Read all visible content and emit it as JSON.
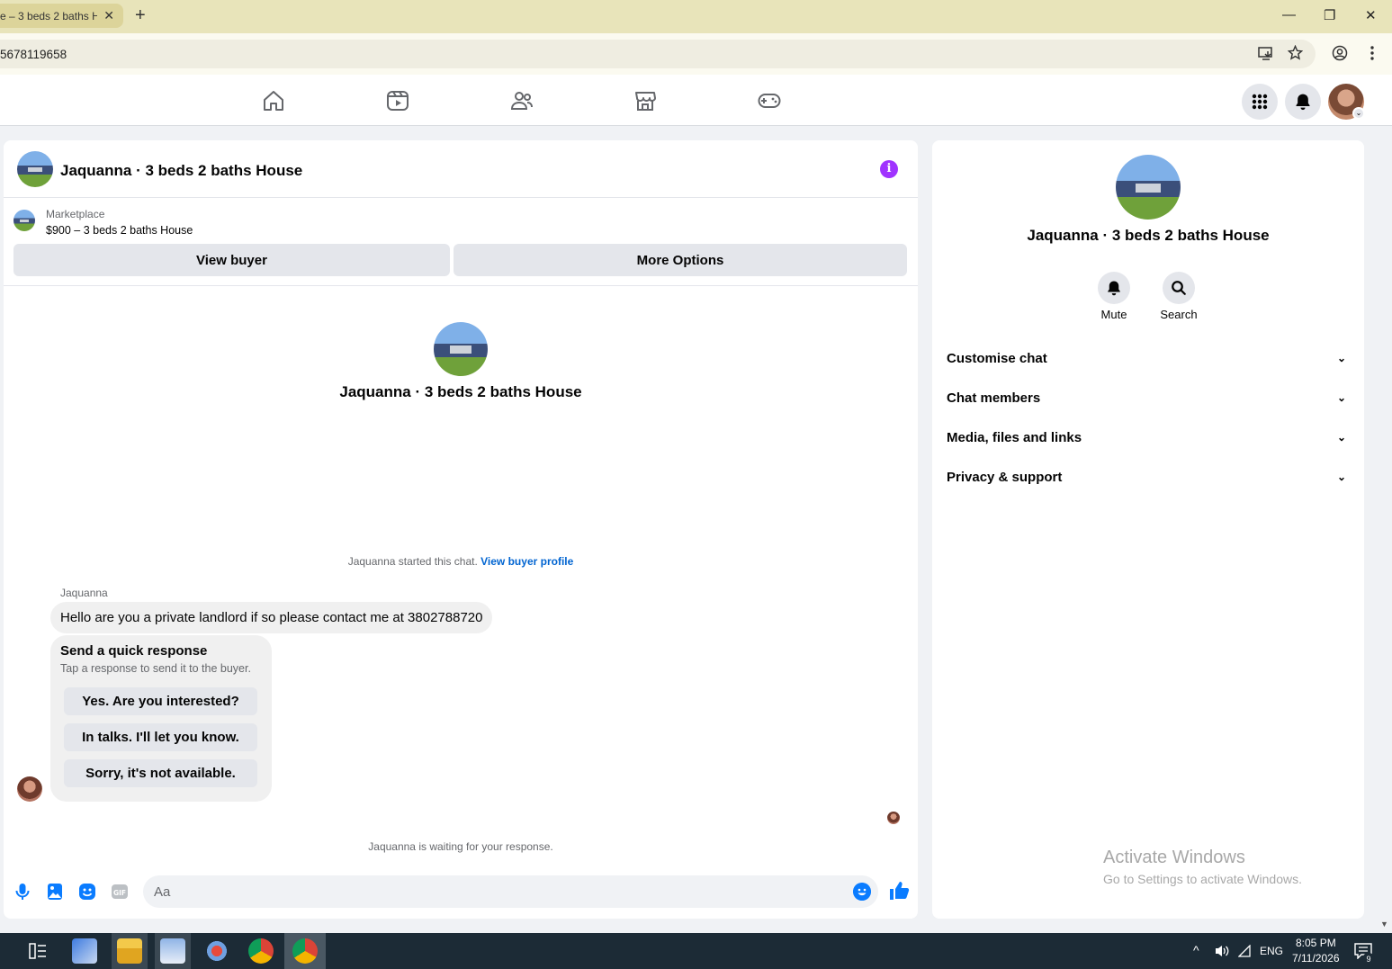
{
  "browser": {
    "tab_title": "e – 3 beds 2 baths H",
    "tab_close": "✕",
    "new_tab": "+",
    "url": "5678119658",
    "window_controls": {
      "minimize": "—",
      "restore": "❐",
      "close": "✕"
    }
  },
  "fb_nav": {
    "icons": [
      "home-icon",
      "video-icon",
      "friends-icon",
      "marketplace-icon",
      "gaming-icon"
    ]
  },
  "chat": {
    "title": "Jaquanna · 3 beds 2 baths House",
    "marketplace_label": "Marketplace",
    "listing_price": "$900 – 3 beds 2 baths House",
    "view_buyer_button": "View buyer",
    "more_options_button": "More Options",
    "center_name": "Jaquanna · 3 beds 2 baths House",
    "started_text": "Jaquanna started this chat.",
    "view_buyer_profile": "View buyer profile",
    "sender_name": "Jaquanna",
    "message": "Hello are you a private landlord if so please contact me at 3802788720",
    "quick_response": {
      "title": "Send a quick response",
      "subtitle": "Tap a response to send it to the buyer.",
      "options": [
        "Yes. Are you interested?",
        "In talks. I'll let you know.",
        "Sorry, it's not available."
      ]
    },
    "waiting_text": "Jaquanna is waiting for your response.",
    "input_placeholder": "Aa"
  },
  "right_panel": {
    "name": "Jaquanna · 3 beds 2 baths House",
    "mute_label": "Mute",
    "search_label": "Search",
    "sections": [
      "Customise chat",
      "Chat members",
      "Media, files and links",
      "Privacy & support"
    ],
    "activate_title": "Activate Windows",
    "activate_sub": "Go to Settings to activate Windows."
  },
  "taskbar": {
    "lang": "ENG",
    "time": "8:05 PM",
    "date": "7/11/2026",
    "notif_count": "9"
  },
  "colors": {
    "accent": "#0a7cff",
    "info": "#a033ff",
    "tab_bar": "#e8e4ba",
    "taskbar": "#1c2b36"
  }
}
